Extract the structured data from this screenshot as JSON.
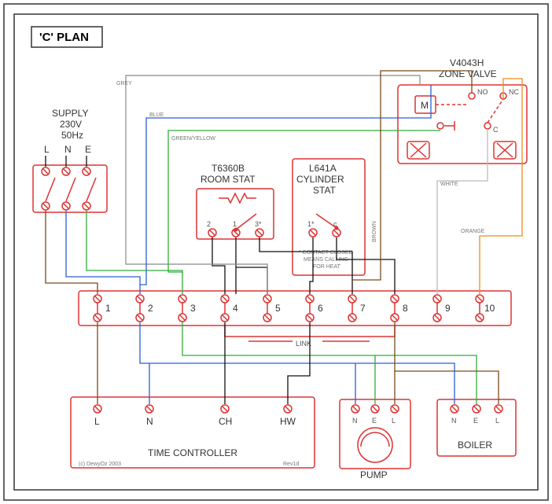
{
  "title": "'C' PLAN",
  "supply": {
    "label": "SUPPLY",
    "voltage": "230V",
    "freq": "50Hz",
    "L": "L",
    "N": "N",
    "E": "E"
  },
  "room_stat": {
    "model": "T6360B",
    "label": "ROOM STAT",
    "t1": "1",
    "t2": "2",
    "t3": "3*"
  },
  "cyl_stat": {
    "model": "L641A",
    "label": "CYLINDER",
    "label2": "STAT",
    "t1": "1*",
    "tc": "c",
    "note1": "* CONTACT CLOSED",
    "note2": "MEANS CALLING",
    "note3": "FOR HEAT"
  },
  "zone_valve": {
    "model": "V4043H",
    "label": "ZONE VALVE",
    "M": "M",
    "NO": "NO",
    "NC": "NC",
    "C": "C"
  },
  "link": "LINK",
  "terminals": {
    "t1": "1",
    "t2": "2",
    "t3": "3",
    "t4": "4",
    "t5": "5",
    "t6": "6",
    "t7": "7",
    "t8": "8",
    "t9": "9",
    "t10": "10"
  },
  "time_controller": {
    "label": "TIME CONTROLLER",
    "L": "L",
    "N": "N",
    "CH": "CH",
    "HW": "HW"
  },
  "pump": {
    "label": "PUMP",
    "N": "N",
    "E": "E",
    "L": "L"
  },
  "boiler": {
    "label": "BOILER",
    "N": "N",
    "E": "E",
    "L": "L"
  },
  "wire_labels": {
    "grey": "GREY",
    "blue": "BLUE",
    "greenyellow": "GREEN/YELLOW",
    "brown": "BROWN",
    "white": "WHITE",
    "orange": "ORANGE"
  },
  "footer": {
    "copyright": "(c) DewyOz 2003",
    "rev": "Rev1d"
  }
}
